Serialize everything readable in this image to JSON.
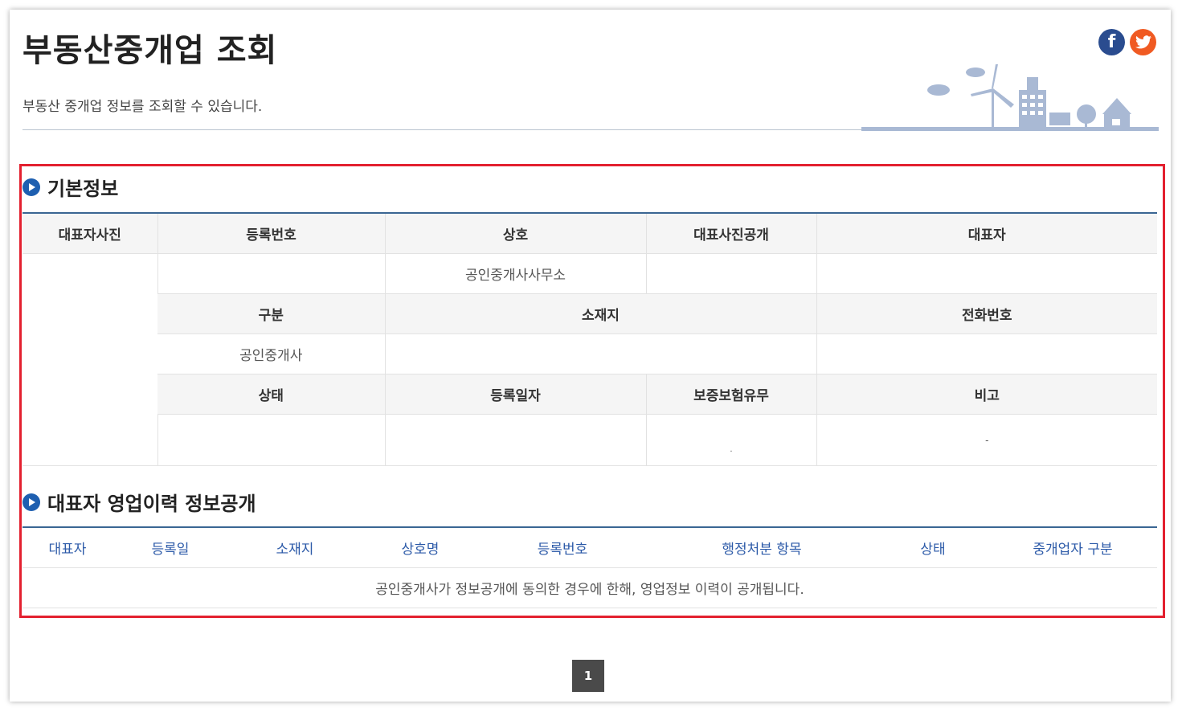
{
  "header": {
    "title": "부동산중개업 조회",
    "description": "부동산 중개업 정보를 조회할 수 있습니다.",
    "sns": [
      {
        "icon": "facebook-icon",
        "glyph": "f",
        "color": "#2a4c8f"
      },
      {
        "icon": "twitter-icon",
        "glyph": "🐦",
        "color": "#f05a22"
      }
    ]
  },
  "basic_info": {
    "section_title": "기본정보",
    "row1_headers": {
      "photo": "대표자사진",
      "reg_no": "등록번호",
      "name": "상호",
      "photo_public": "대표사진공개",
      "rep": "대표자"
    },
    "row1_values": {
      "reg_no": "",
      "name": "공인중개사사무소",
      "photo_public": "",
      "rep": ""
    },
    "row2_headers": {
      "category": "구분",
      "address": "소재지",
      "phone": "전화번호"
    },
    "row2_values": {
      "category": "공인중개사",
      "address": "",
      "phone": ""
    },
    "row3_headers": {
      "status": "상태",
      "reg_date": "등록일자",
      "insurance": "보증보험유무",
      "note": "비고"
    },
    "row3_values": {
      "status": "",
      "reg_date": "",
      "insurance": ".",
      "note": "-"
    }
  },
  "history": {
    "section_title": "대표자 영업이력 정보공개",
    "headers": [
      "대표자",
      "등록일",
      "소재지",
      "상호명",
      "등록번호",
      "행정처분 항목",
      "상태",
      "중개업자 구분"
    ],
    "notice": "공인중개사가 정보공개에 동의한 경우에 한해, 영업정보 이력이 공개됩니다."
  },
  "pagination": {
    "current": "1"
  },
  "colors": {
    "accent": "#1e5fb0",
    "highlight": "#e3202f",
    "table_rule": "#3a6693"
  }
}
